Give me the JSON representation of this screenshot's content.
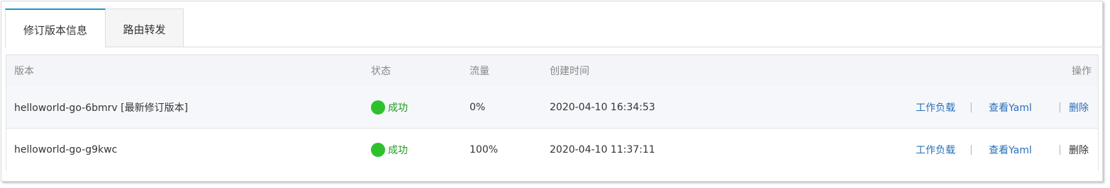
{
  "tabs": [
    {
      "label": "修订版本信息",
      "active": true
    },
    {
      "label": "路由转发",
      "active": false
    }
  ],
  "table": {
    "headers": {
      "version": "版本",
      "status": "状态",
      "traffic": "流量",
      "created": "创建时间",
      "actions": "操作"
    },
    "rows": [
      {
        "version": "helloworld-go-6bmrv [最新修订版本]",
        "status": "成功",
        "traffic": "0%",
        "created": "2020-04-10 16:34:53",
        "action_workload": "工作负载",
        "action_yaml": "查看Yaml",
        "action_delete": "删除"
      },
      {
        "version": "helloworld-go-g9kwc",
        "status": "成功",
        "traffic": "100%",
        "created": "2020-04-10 11:37:11",
        "action_workload": "工作负载",
        "action_yaml": "查看Yaml",
        "action_delete": "删除"
      }
    ],
    "separator": "|"
  },
  "colors": {
    "accent": "#1a97c8",
    "success": "#2ec12e",
    "link": "#2a6fb8"
  }
}
